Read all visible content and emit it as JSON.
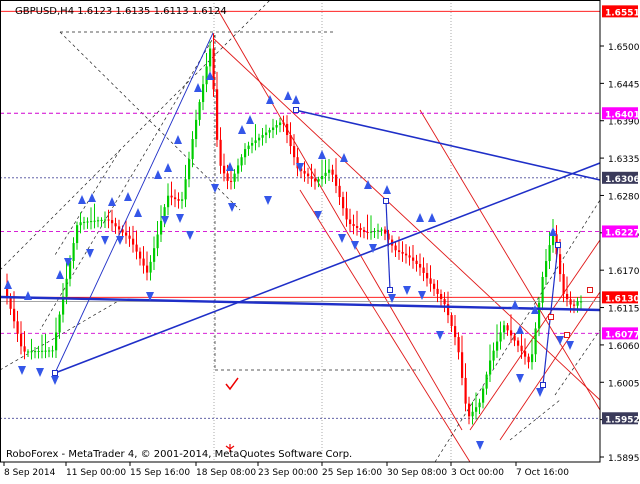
{
  "chart_data": {
    "type": "candlestick",
    "symbol_line": "GBPUSD,H4  1.6123 1.6135 1.6113 1.6124",
    "footer": "RoboForex - MetaTrader 4, © 2001-2014, MetaQuotes Software Corp.",
    "ylim": [
      1.5922,
      1.6568
    ],
    "y_ticks": [
      1.65,
      1.6445,
      1.639,
      1.6335,
      1.628,
      1.6225,
      1.617,
      1.6115,
      1.606,
      1.6005,
      1.595,
      1.5895
    ],
    "y_tick_labels": [
      "1.6500",
      "1.6445",
      "1.6390",
      "1.6335",
      "1.6280",
      "1.6225",
      "1.6170",
      "1.6115",
      "1.6060",
      "1.6005",
      "1.5950",
      "1.5895"
    ],
    "x_labels": [
      "8 Sep 2014",
      "11 Sep 00:00",
      "15 Sep 16:00",
      "18 Sep 08:00",
      "23 Sep 00:00",
      "25 Sep 16:00",
      "30 Sep 08:00",
      "3 Oct 00:00",
      "7 Oct 16:00"
    ],
    "levels": [
      {
        "value": 1.6551,
        "label": "1.6551",
        "kind": "red"
      },
      {
        "value": 1.6401,
        "label": "1.6401",
        "kind": "magenta"
      },
      {
        "value": 1.6306,
        "label": "1.6306",
        "kind": "dark"
      },
      {
        "value": 1.6227,
        "label": "1.6227",
        "kind": "magenta"
      },
      {
        "value": 1.613,
        "label": "1.6130",
        "kind": "red"
      },
      {
        "value": 1.6077,
        "label": "1.6077",
        "kind": "magenta"
      },
      {
        "value": 1.5952,
        "label": "1.5952",
        "kind": "dark"
      }
    ],
    "current_price": 1.6124,
    "colors": {
      "bull": "#00cc00",
      "bear": "#ff0000",
      "trend_blue": "#1f2fc8",
      "channel_red": "#e01818",
      "level_magenta": "#d000d0",
      "level_red": "#ff0000",
      "level_dark": "#4a4a9a",
      "label_box_magenta": "#ff00ff",
      "label_box_red": "#ff0000",
      "label_box_dark": "#3a3a5a",
      "fractal": "#3456e8"
    }
  }
}
